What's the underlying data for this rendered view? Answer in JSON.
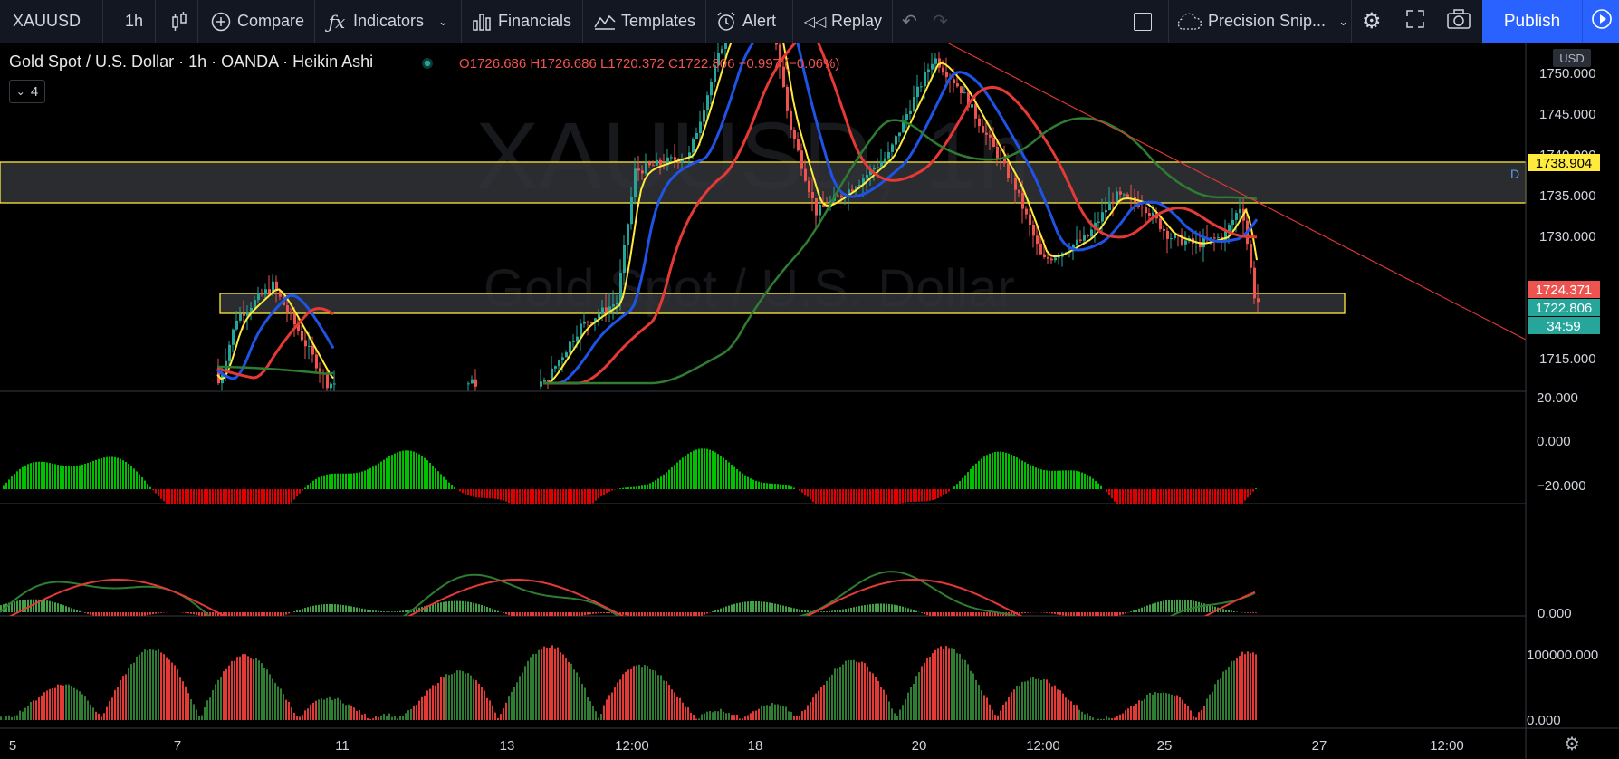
{
  "toolbar": {
    "symbol": "XAUUSD",
    "interval": "1h",
    "compare": "Compare",
    "indicators": "Indicators",
    "financials": "Financials",
    "templates": "Templates",
    "alert": "Alert",
    "replay": "Replay",
    "layout_name": "Precision Snip...",
    "publish": "Publish"
  },
  "legend": {
    "title": "Gold Spot / U.S. Dollar · 1h · OANDA · Heikin Ashi",
    "ohlc": "O1726.686  H1726.686  L1720.372  C1722.806  −0.997 (−0.06%)",
    "collapse_count": "4"
  },
  "watermark": {
    "symbol": "XAUUSD, 1h",
    "name": "Gold Spot / U.S. Dollar"
  },
  "price_axis": {
    "currency": "USD",
    "ticks": [
      "1750.000",
      "1745.000",
      "1740.000",
      "1735.000",
      "1730.000",
      "1715.000"
    ],
    "labels": [
      {
        "text": "1738.904",
        "color": "#ffeb3b",
        "fg": "#000000"
      },
      {
        "text": "1724.371",
        "color": "#ef5350",
        "fg": "#ffffff"
      },
      {
        "text": "1722.806",
        "color": "#26a69a",
        "fg": "#ffffff"
      },
      {
        "text": "34:59",
        "color": "#26a69a",
        "fg": "#ffffff"
      }
    ],
    "marker": "D"
  },
  "osc1_ticks": [
    "20.000",
    "0.000",
    "−20.000"
  ],
  "osc2_ticks": [
    "0.000"
  ],
  "volume_ticks": [
    "100000.000",
    "0.000"
  ],
  "time_axis": [
    "5",
    "7",
    "11",
    "13",
    "12:00",
    "18",
    "20",
    "12:00",
    "25",
    "27",
    "12:00"
  ],
  "colors": {
    "up": "#26a69a",
    "down": "#ef5350",
    "yellow": "#ffeb3b",
    "blue": "#1e53e5",
    "red": "#e53935",
    "green": "#2e7d32"
  }
}
